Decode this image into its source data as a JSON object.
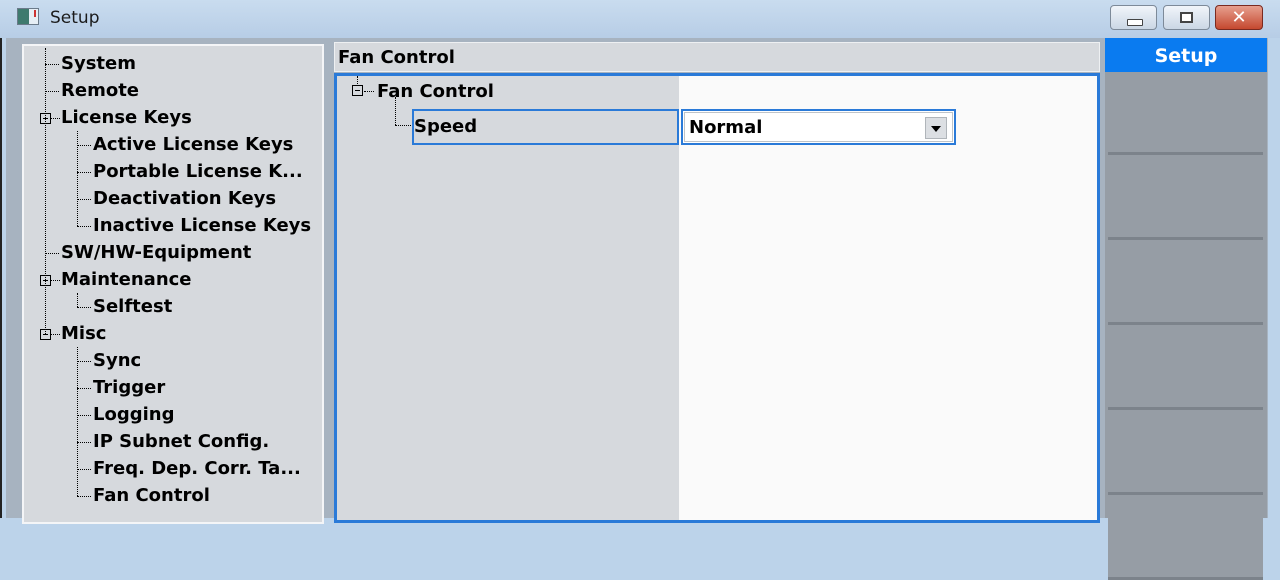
{
  "window": {
    "title": "Setup",
    "icon": "app-window-icon",
    "controls": {
      "minimize_icon": "minimize-icon",
      "maximize_icon": "maximize-icon",
      "close_label": "✕"
    }
  },
  "tree": {
    "items": [
      {
        "label": "System",
        "level": 0,
        "expander": false
      },
      {
        "label": "Remote",
        "level": 0,
        "expander": false
      },
      {
        "label": "License Keys",
        "level": 0,
        "expander": true
      },
      {
        "label": "Active License Keys",
        "level": 1,
        "expander": false
      },
      {
        "label": "Portable License K...",
        "level": 1,
        "expander": false
      },
      {
        "label": "Deactivation Keys",
        "level": 1,
        "expander": false
      },
      {
        "label": "Inactive License Keys",
        "level": 1,
        "expander": false
      },
      {
        "label": "SW/HW-Equipment",
        "level": 0,
        "expander": false
      },
      {
        "label": "Maintenance",
        "level": 0,
        "expander": true
      },
      {
        "label": "Selftest",
        "level": 1,
        "expander": false
      },
      {
        "label": "Misc",
        "level": 0,
        "expander": true
      },
      {
        "label": "Sync",
        "level": 1,
        "expander": false
      },
      {
        "label": "Trigger",
        "level": 1,
        "expander": false
      },
      {
        "label": "Logging",
        "level": 1,
        "expander": false
      },
      {
        "label": "IP Subnet Config.",
        "level": 1,
        "expander": false
      },
      {
        "label": "Freq. Dep. Corr. Ta...",
        "level": 1,
        "expander": false
      },
      {
        "label": "Fan Control",
        "level": 1,
        "expander": false
      }
    ]
  },
  "content": {
    "header": "Fan Control",
    "group_label": "Fan Control",
    "setting_label": "Speed",
    "setting_value": "Normal"
  },
  "side_panel": {
    "title": "Setup",
    "buttons": [
      "",
      "",
      "",
      "",
      "",
      ""
    ]
  },
  "colors": {
    "accent": "#0a7bf0",
    "focus_border": "#2a7ad8",
    "panel_bg": "#d6d9dd",
    "side_bg": "#969da5"
  }
}
